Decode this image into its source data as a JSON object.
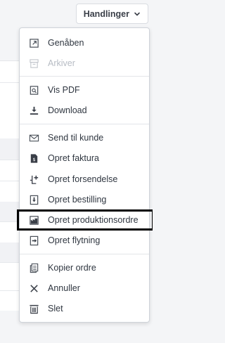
{
  "header": {
    "actions_label": "Handlinger"
  },
  "colors": {
    "selected_outline": "#000000",
    "text": "#2f3640",
    "disabled": "#b7bcc4"
  },
  "menu": {
    "items": [
      {
        "label": "Genåben",
        "icon": "reopen-icon",
        "disabled": false
      },
      {
        "label": "Arkiver",
        "icon": "archive-icon",
        "disabled": true
      },
      {
        "label": "Vis PDF",
        "icon": "view-pdf-icon",
        "disabled": false
      },
      {
        "label": "Download",
        "icon": "download-icon",
        "disabled": false
      },
      {
        "label": "Send til kunde",
        "icon": "envelope-icon",
        "disabled": false
      },
      {
        "label": "Opret faktura",
        "icon": "invoice-icon",
        "disabled": false
      },
      {
        "label": "Opret forsendelse",
        "icon": "shipment-icon",
        "disabled": false
      },
      {
        "label": "Opret bestilling",
        "icon": "purchase-order-icon",
        "disabled": false
      },
      {
        "label": "Opret produktionsordre",
        "icon": "factory-icon",
        "disabled": false,
        "selected": true
      },
      {
        "label": "Opret flytning",
        "icon": "move-icon",
        "disabled": false
      },
      {
        "label": "Kopier ordre",
        "icon": "copy-icon",
        "disabled": false
      },
      {
        "label": "Annuller",
        "icon": "close-icon",
        "disabled": false
      },
      {
        "label": "Slet",
        "icon": "trash-icon",
        "disabled": false
      }
    ]
  }
}
